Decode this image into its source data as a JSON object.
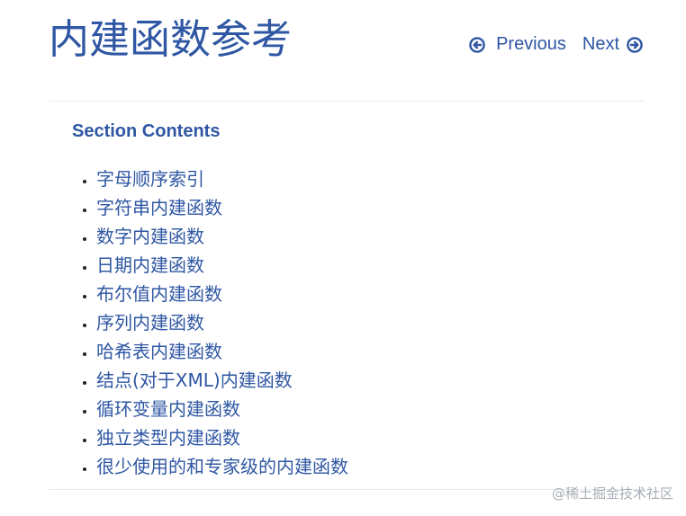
{
  "header": {
    "title": "内建函数参考",
    "nav": {
      "previous_label": "Previous",
      "next_label": "Next",
      "previous_icon": "arrow-circle-left-icon",
      "next_icon": "arrow-circle-right-icon"
    }
  },
  "section": {
    "heading": "Section Contents",
    "items": [
      {
        "label": "字母顺序索引"
      },
      {
        "label": "字符串内建函数"
      },
      {
        "label": "数字内建函数"
      },
      {
        "label": "日期内建函数"
      },
      {
        "label": "布尔值内建函数"
      },
      {
        "label": "序列内建函数"
      },
      {
        "label": "哈希表内建函数"
      },
      {
        "label": "结点(对于XML)内建函数"
      },
      {
        "label": "循环变量内建函数"
      },
      {
        "label": "独立类型内建函数"
      },
      {
        "label": "很少使用的和专家级的内建函数"
      }
    ]
  },
  "watermark": "@稀土掘金技术社区",
  "colors": {
    "link": "#2f57a3",
    "divider": "#e9ecef",
    "watermark": "#a7adb5"
  }
}
